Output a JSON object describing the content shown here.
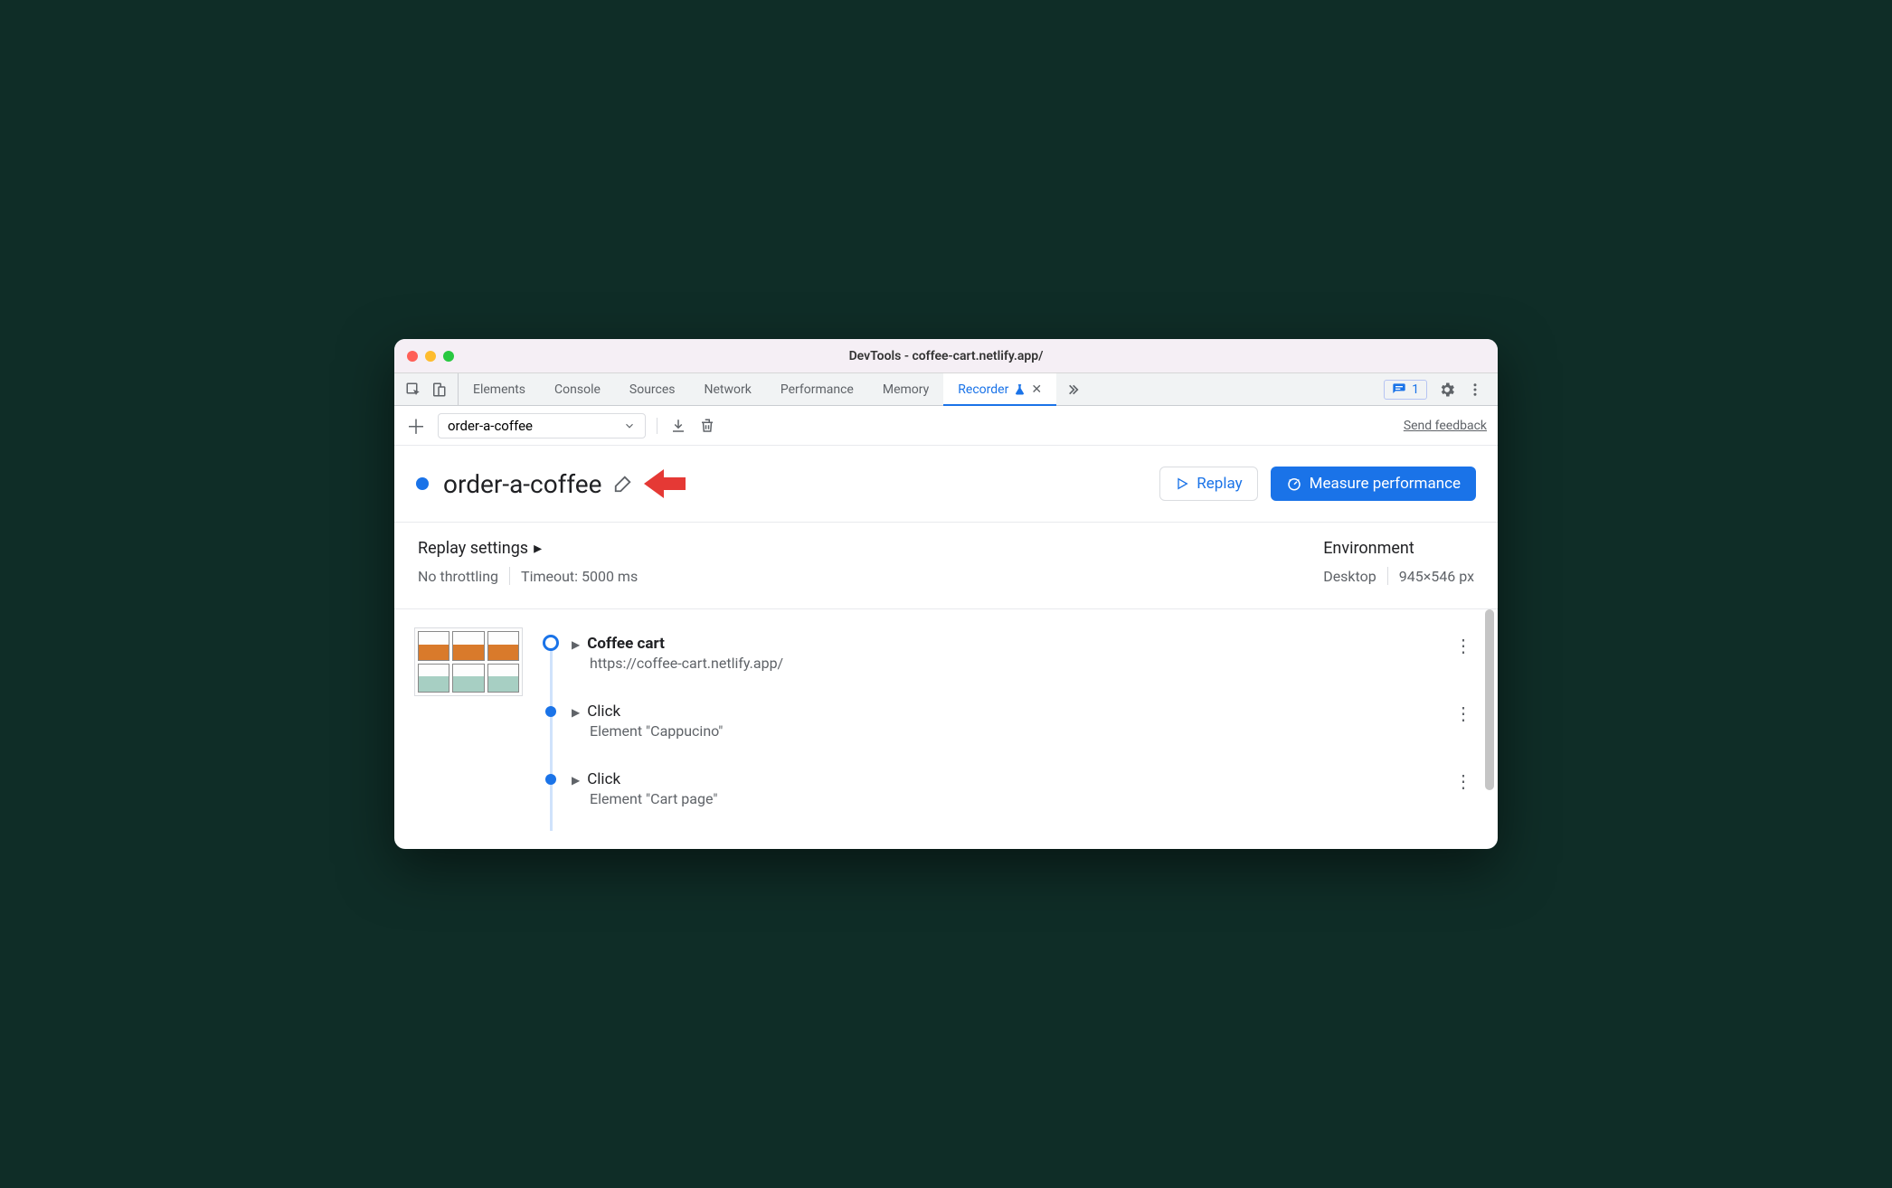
{
  "window": {
    "title": "DevTools - coffee-cart.netlify.app/"
  },
  "tabs": {
    "items": [
      "Elements",
      "Console",
      "Sources",
      "Network",
      "Performance",
      "Memory",
      "Recorder"
    ],
    "active": "Recorder",
    "issues_count": "1"
  },
  "toolbar": {
    "recording_name": "order-a-coffee",
    "send_feedback": "Send feedback"
  },
  "header": {
    "title": "order-a-coffee",
    "replay_label": "Replay",
    "measure_label": "Measure performance"
  },
  "settings": {
    "replay_title": "Replay settings",
    "throttling": "No throttling",
    "timeout": "Timeout: 5000 ms",
    "env_title": "Environment",
    "env_device": "Desktop",
    "env_viewport": "945×546 px"
  },
  "steps": [
    {
      "title": "Coffee cart",
      "sub": "https://coffee-cart.netlify.app/",
      "bold": true,
      "big_marker": true
    },
    {
      "title": "Click",
      "sub": "Element \"Cappucino\"",
      "bold": false,
      "big_marker": false
    },
    {
      "title": "Click",
      "sub": "Element \"Cart page\"",
      "bold": false,
      "big_marker": false
    }
  ]
}
